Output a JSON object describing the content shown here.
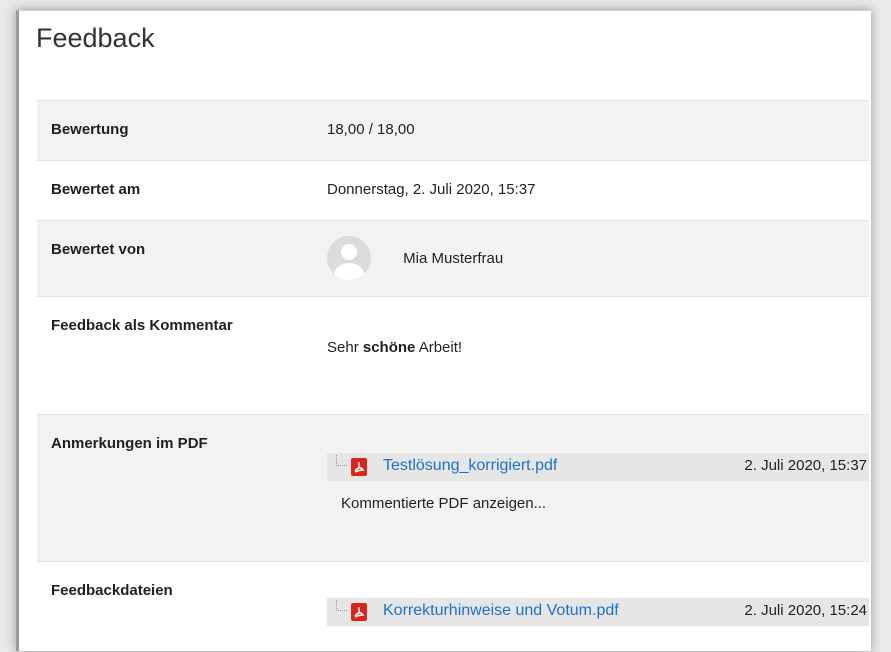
{
  "page": {
    "title": "Feedback"
  },
  "rows": {
    "grade": {
      "label": "Bewertung",
      "value": "18,00 / 18,00"
    },
    "graded_on": {
      "label": "Bewertet am",
      "value": "Donnerstag, 2. Juli 2020, 15:37"
    },
    "graded_by": {
      "label": "Bewertet von",
      "value": "Mia Musterfrau"
    },
    "comment": {
      "label": "Feedback als Kommentar",
      "prefix": "Sehr",
      "bold": "schöne",
      "suffix": "Arbeit!"
    },
    "pdf_annotations": {
      "label": "Anmerkungen im PDF",
      "file": {
        "name": "Testlösung_korrigiert.pdf",
        "date": "2. Juli 2020, 15:37",
        "icon": "pdf-icon"
      },
      "link": "Kommentierte PDF anzeigen..."
    },
    "feedback_files": {
      "label": "Feedbackdateien",
      "file": {
        "name": "Korrekturhinweise und Votum.pdf",
        "date": "2. Juli 2020, 15:24",
        "icon": "pdf-icon"
      }
    }
  },
  "colors": {
    "link": "#1a73c8",
    "pdf_red": "#d9261c",
    "row_alt": "#f2f2f2"
  }
}
